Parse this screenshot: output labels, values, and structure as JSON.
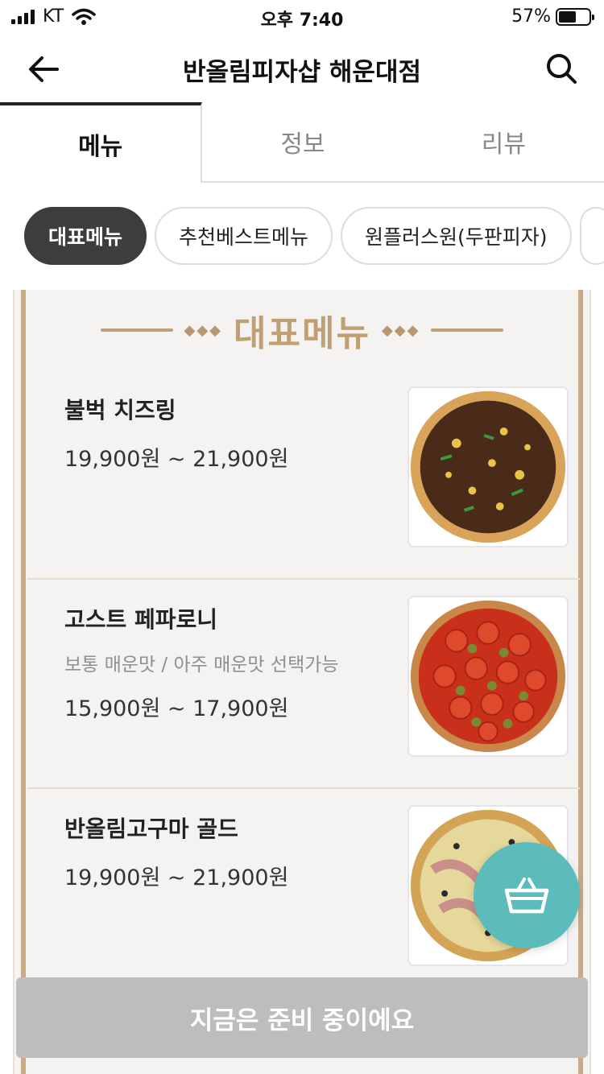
{
  "status_bar": {
    "carrier": "KT",
    "time": "오후 7:40",
    "battery_percent": "57%",
    "battery_level": 0.57
  },
  "header": {
    "title": "반올림피자샵 해운대점",
    "back_icon": "back-arrow-icon",
    "search_icon": "search-icon"
  },
  "tabs": [
    {
      "label": "메뉴",
      "active": true
    },
    {
      "label": "정보",
      "active": false
    },
    {
      "label": "리뷰",
      "active": false
    }
  ],
  "chips": [
    {
      "label": "대표메뉴",
      "active": true
    },
    {
      "label": "추천베스트메뉴",
      "active": false
    },
    {
      "label": "원플러스원(두판피자)",
      "active": false
    }
  ],
  "section": {
    "title": "대표메뉴"
  },
  "items": [
    {
      "name": "불벅 치즈링",
      "desc": "",
      "price": "19,900원 ~ 21,900원"
    },
    {
      "name": "고스트 페파로니",
      "desc": "보통 매운맛 / 아주 매운맛 선택가능",
      "price": "15,900원 ~ 17,900원"
    },
    {
      "name": "반올림고구마 골드",
      "desc": "",
      "price": "19,900원 ~ 21,900원"
    }
  ],
  "cart": {
    "icon": "basket-icon"
  },
  "bottom_button": {
    "label": "지금은 준비 중이에요"
  },
  "colors": {
    "accent_gold": "#c19f74",
    "cart_teal": "#5bbcbb",
    "chip_active": "#3d3d3d",
    "disabled_button": "#bdbdbd"
  }
}
